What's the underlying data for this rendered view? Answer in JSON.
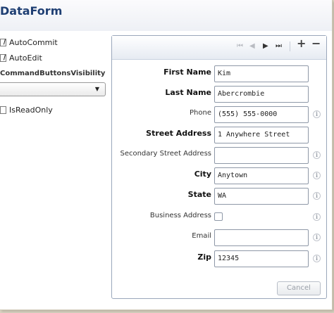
{
  "title": "DataForm",
  "options": {
    "auto_commit": {
      "label": "AutoCommit",
      "checked": true
    },
    "auto_edit": {
      "label": "AutoEdit",
      "checked": true
    },
    "visibility_label": "CommandButtonsVisibility",
    "visibility_value": "",
    "is_read_only": {
      "label": "IsReadOnly",
      "checked": false
    }
  },
  "nav": {
    "first": "⏮",
    "prev": "◀",
    "next": "▶",
    "last": "⏭",
    "add": "+",
    "delete": "−"
  },
  "fields": {
    "first_name": {
      "label": "First Name",
      "value": "Kim"
    },
    "last_name": {
      "label": "Last Name",
      "value": "Abercrombie"
    },
    "phone": {
      "label": "Phone",
      "value": "(555) 555-0000"
    },
    "street_address": {
      "label": "Street Address",
      "value": "1 Anywhere Street"
    },
    "secondary_street_address": {
      "label": "Secondary Street Address",
      "value": ""
    },
    "city": {
      "label": "City",
      "value": "Anytown"
    },
    "state": {
      "label": "State",
      "value": "WA"
    },
    "business_address": {
      "label": "Business Address",
      "checked": false
    },
    "email": {
      "label": "Email",
      "value": ""
    },
    "zip": {
      "label": "Zip",
      "value": "12345"
    }
  },
  "info_glyph": "i",
  "cancel_label": "Cancel"
}
